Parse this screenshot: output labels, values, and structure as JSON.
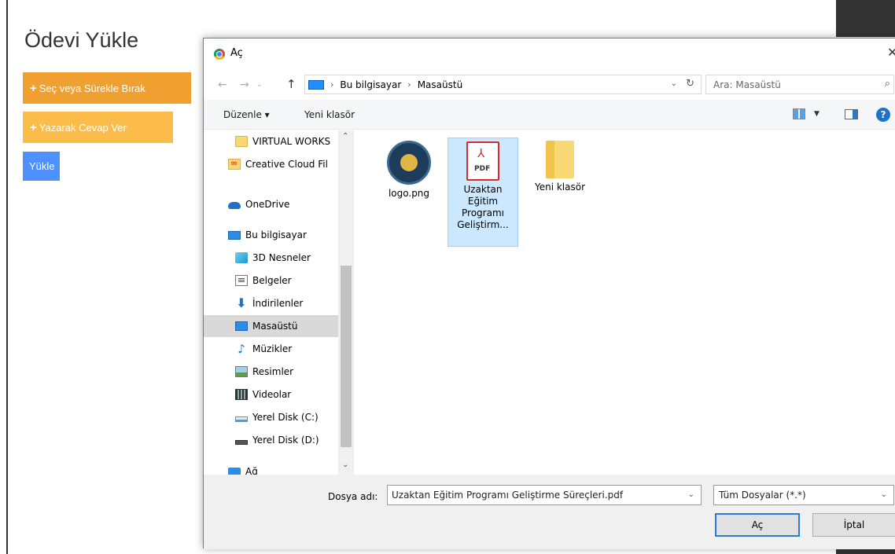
{
  "page": {
    "title": "Ödevi Yükle",
    "buttons": {
      "secim": "Seç veya Sürekle Bırak",
      "yazarak": "Yazarak Cevap Ver",
      "yukle": "Yükle"
    },
    "plus_glyph": "+"
  },
  "dialog": {
    "title": "Aç",
    "close_glyph": "✕",
    "nav": {
      "back": "←",
      "forward": "→",
      "history": "⌄",
      "up": "↑",
      "breadcrumb": [
        "Bu bilgisayar",
        "Masaüstü"
      ],
      "separator": "›",
      "dropdown": "⌄",
      "refresh": "↻"
    },
    "search": {
      "placeholder": "Ara: Masaüstü",
      "icon": "⌕"
    },
    "toolbar": {
      "organize": "Düzenle ▾",
      "new_folder": "Yeni klasör",
      "view_dropdown": "▼",
      "help": "?"
    },
    "sidebar": {
      "items": [
        {
          "label": "VIRTUAL WORKS",
          "icon": "folder-icon"
        },
        {
          "label": "Creative Cloud Fil",
          "icon": "creative-cloud-icon"
        },
        {
          "label": "OneDrive",
          "icon": "onedrive-icon"
        },
        {
          "label": "Bu bilgisayar",
          "icon": "computer-icon"
        },
        {
          "label": "3D Nesneler",
          "icon": "3d-objects-icon"
        },
        {
          "label": "Belgeler",
          "icon": "documents-icon"
        },
        {
          "label": "İndirilenler",
          "icon": "downloads-icon"
        },
        {
          "label": "Masaüstü",
          "icon": "desktop-icon",
          "selected": true
        },
        {
          "label": "Müzikler",
          "icon": "music-icon"
        },
        {
          "label": "Resimler",
          "icon": "pictures-icon"
        },
        {
          "label": "Videolar",
          "icon": "videos-icon"
        },
        {
          "label": "Yerel Disk (C:)",
          "icon": "local-disk-c-icon"
        },
        {
          "label": "Yerel Disk (D:)",
          "icon": "local-disk-d-icon"
        },
        {
          "label": "Ağ",
          "icon": "network-icon"
        }
      ],
      "scroll_up": "⌃",
      "scroll_down": "⌄"
    },
    "files": [
      {
        "name": "logo.png",
        "icon": "image-logo-icon"
      },
      {
        "name": "Uzaktan Eğitim Programı Geliştirm...",
        "icon": "pdf-file-icon",
        "selected": true,
        "icon_text": "PDF",
        "acrobat": "⅄"
      },
      {
        "name": "Yeni klasör",
        "icon": "folder-icon"
      }
    ],
    "bottom": {
      "filename_label": "Dosya adı:",
      "filename_value": "Uzaktan Eğitim Programı Geliştirme Süreçleri.pdf",
      "filetype": "Tüm Dosyalar (*.*)",
      "dropdown": "⌄",
      "open_button": "Aç",
      "cancel_button": "İptal"
    }
  }
}
